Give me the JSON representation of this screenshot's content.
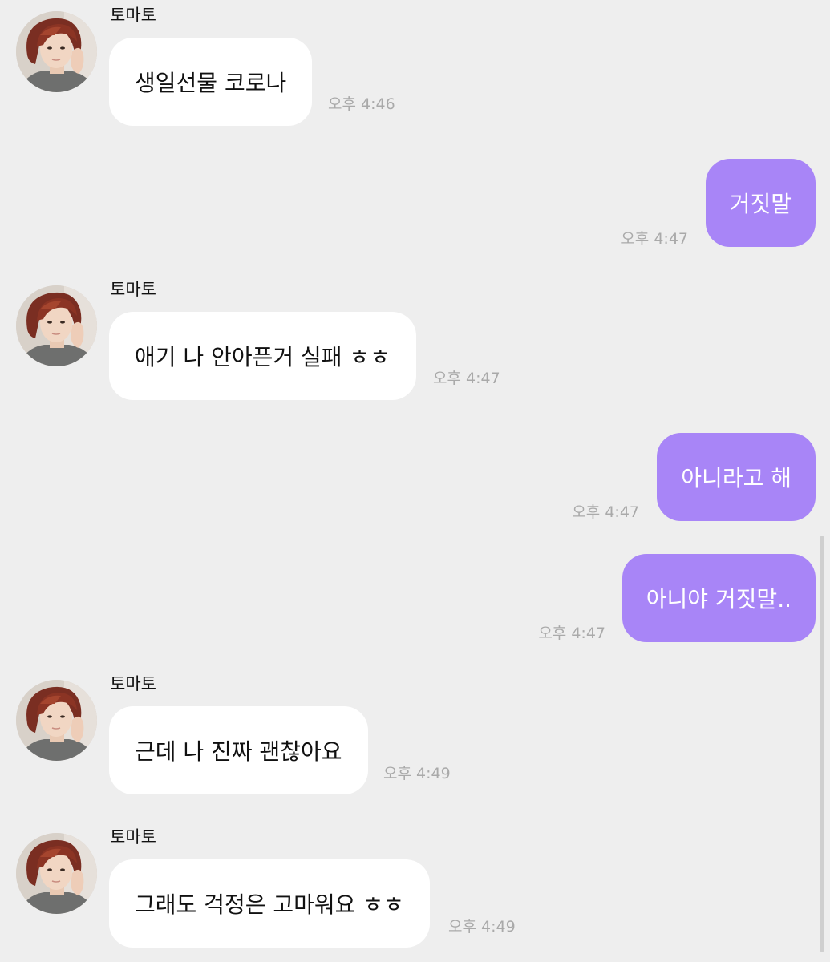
{
  "messages": [
    {
      "sender": "토마토",
      "text": "생일선물 코로나",
      "time": "오후 4:46"
    },
    {
      "text": "거짓말",
      "time": "오후 4:47"
    },
    {
      "sender": "토마토",
      "text": "애기 나 안아픈거 실패 ㅎㅎ",
      "time": "오후 4:47"
    },
    {
      "text": "아니라고 해",
      "time": "오후 4:47"
    },
    {
      "text": "아니야 거짓말..",
      "time": "오후 4:47"
    },
    {
      "sender": "토마토",
      "text": "근데 나 진짜 괜찮아요",
      "time": "오후 4:49"
    },
    {
      "sender": "토마토",
      "text": "그래도 걱정은 고마워요 ㅎㅎ",
      "time": "오후 4:49"
    }
  ],
  "colors": {
    "background": "#eeeeee",
    "incoming_bubble": "#ffffff",
    "outgoing_bubble": "#a885f7",
    "timestamp": "#a9a9a9"
  }
}
